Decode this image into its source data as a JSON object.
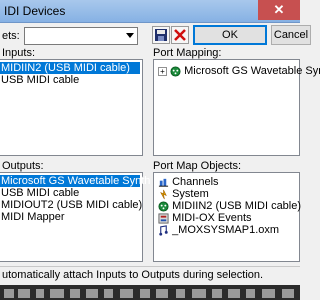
{
  "window": {
    "title": "IDI Devices",
    "close_glyph": "✕"
  },
  "toolbar": {
    "presets_label": "ets:",
    "presets_value": "",
    "ok_label": "OK",
    "cancel_label": "Cancel",
    "save_icon": "save-icon",
    "delete_icon": "delete-icon"
  },
  "inputs": {
    "label": "Inputs:",
    "items": [
      {
        "label": "MIDIIN2 (USB MIDI cable)",
        "selected": true
      },
      {
        "label": "USB MIDI cable",
        "selected": false
      }
    ]
  },
  "port_mapping": {
    "label": "Port Mapping:",
    "items": [
      {
        "label": "Microsoft GS Wavetable Synth",
        "expand_glyph": "+",
        "icon": "midi-port-icon"
      }
    ]
  },
  "outputs": {
    "label": "Outputs:",
    "items": [
      {
        "label": "Microsoft GS Wavetable Synth",
        "selected": true
      },
      {
        "label": "USB MIDI cable",
        "selected": false
      },
      {
        "label": "MIDIOUT2 (USB MIDI cable)",
        "selected": false
      },
      {
        "label": "MIDI Mapper",
        "selected": false
      }
    ]
  },
  "port_map_objects": {
    "label": "Port Map Objects:",
    "items": [
      {
        "label": "Channels",
        "icon": "channels-icon"
      },
      {
        "label": "System",
        "icon": "system-icon"
      },
      {
        "label": "MIDIIN2 (USB MIDI cable)",
        "icon": "midi-in-icon"
      },
      {
        "label": "MIDI-OX Events",
        "icon": "midi-ox-events-icon"
      },
      {
        "label": "_MOXSYSMAP1.oxm",
        "icon": "oxm-file-icon"
      }
    ]
  },
  "status": {
    "text": "utomatically attach Inputs to Outputs during selection."
  },
  "colors": {
    "selection": "#0078d7",
    "titlebar": "#99bce8",
    "close": "#c75050"
  }
}
